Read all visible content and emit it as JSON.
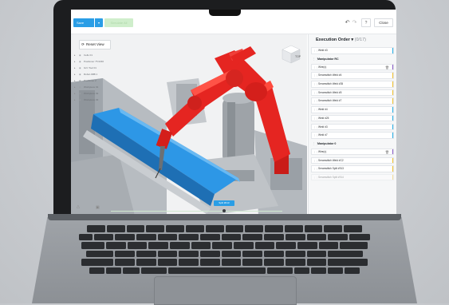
{
  "toolbar": {
    "save_label": "Save",
    "save_dropdown_icon": "chevron-down-icon",
    "green_button_label": "Simulate All",
    "undo_icon": "undo-icon",
    "redo_icon": "redo-icon",
    "help_label": "?",
    "close_label": "Close"
  },
  "viewport": {
    "reset_view_label": "Reset View",
    "tree_items": [
      {
        "label": "Cello 01"
      },
      {
        "label": "Positioner 75 0230"
      },
      {
        "label": "GrC Tool 01"
      },
      {
        "label": "Robot ABB 1"
      },
      {
        "label": "Positioner 2"
      },
      {
        "label": "Workpiece 01"
      },
      {
        "label": "Workpiece 02"
      },
      {
        "label": "Workpiece 03"
      }
    ],
    "view_cube_label": "TOP",
    "timeline_label": "Split #013",
    "timeline_progress": 0.66,
    "robot_color": "#e52521",
    "rail_color": "#2b8fe0"
  },
  "execution": {
    "title": "Execution Order",
    "count": "(0/17)",
    "items": [
      {
        "kind": "item",
        "label": "Weld #3",
        "color": "#2ab0e6"
      },
      {
        "kind": "group",
        "label": "Manipulator RC"
      },
      {
        "kind": "item",
        "label": "Wire(c)",
        "color": "#8b5cc7",
        "trash": true
      },
      {
        "kind": "item",
        "label": "Seramstitch Weld #4",
        "color": "#f2c230"
      },
      {
        "kind": "item",
        "label": "Seramstitch Weld #35",
        "color": "#f2c230"
      },
      {
        "kind": "item",
        "label": "Seramstitch Weld #5",
        "color": "#f2c230"
      },
      {
        "kind": "item",
        "label": "Seramstitch Weld #7",
        "color": "#f2c230"
      },
      {
        "kind": "item",
        "label": "Weld #4",
        "color": "#2ab0e6"
      },
      {
        "kind": "item",
        "label": "Weld #25",
        "color": "#2ab0e6"
      },
      {
        "kind": "item",
        "label": "Weld #3",
        "color": "#2ab0e6"
      },
      {
        "kind": "item",
        "label": "Weld #7",
        "color": "#2ab0e6"
      },
      {
        "kind": "group",
        "label": "Manipulator 0"
      },
      {
        "kind": "item",
        "label": "Wire(c)",
        "color": "#8b5cc7",
        "trash": true
      },
      {
        "kind": "item",
        "label": "Seramstitch Weld #C2",
        "color": "#f2c230"
      },
      {
        "kind": "item",
        "label": "Seramstitch Split #913",
        "color": "#f2c230"
      },
      {
        "kind": "item",
        "label": "Seramstitch Split #914",
        "color": "#f2c230",
        "faded": true
      }
    ]
  }
}
